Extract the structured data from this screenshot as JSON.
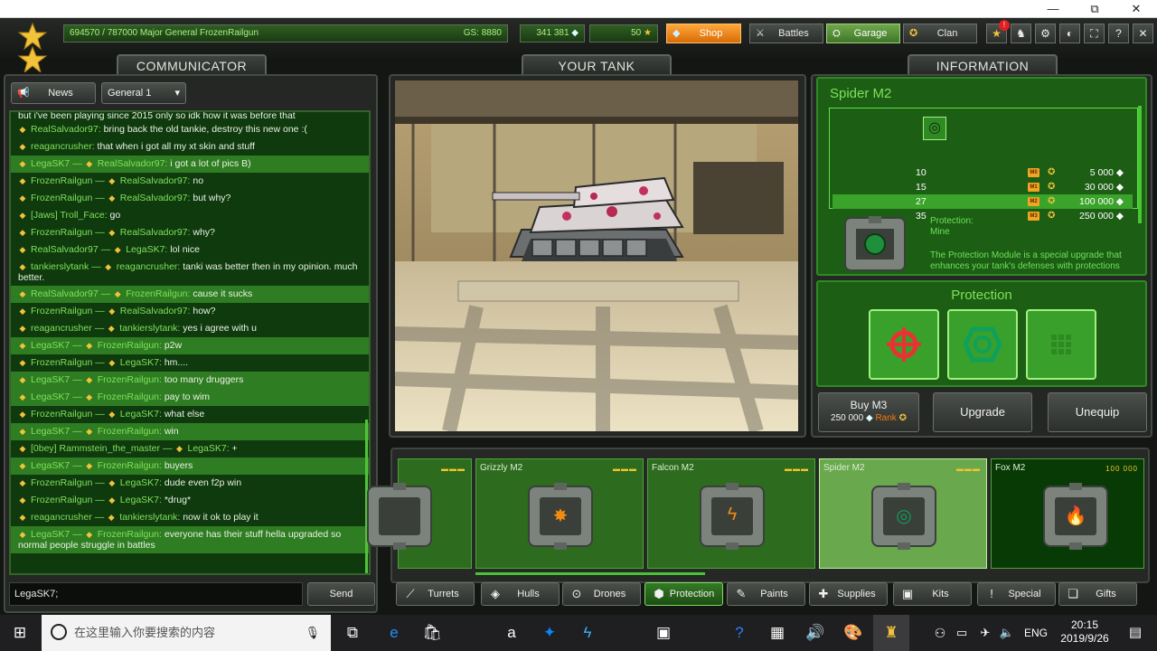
{
  "window": {
    "controls": {
      "minimize": "—",
      "restore": "⧉",
      "close": "✕"
    }
  },
  "topbar": {
    "player_info": "694570 / 787000  Major General FrozenRailgun",
    "gear_score": "GS: 8880",
    "crystals": "341 381",
    "stars": "50",
    "shop": "Shop",
    "battles": "Battles",
    "garage": "Garage",
    "clan": "Clan",
    "notification_count": "!"
  },
  "headers": {
    "communicator": "COMMUNICATOR",
    "your_tank": "YOUR TANK",
    "information": "INFORMATION"
  },
  "chat": {
    "news_button": "News",
    "channel": "General 1",
    "input_value": "LegaSK7;",
    "send": "Send",
    "truncated_top": "but i've been playing since 2015 only so idk how it was before that",
    "messages": [
      {
        "from": "RealSalvador97:",
        "to": "",
        "text": "bring back the old tankie, destroy this new one :(",
        "hl": false
      },
      {
        "from": "reagancrusher:",
        "to": "",
        "text": "that when i got all my xt skin and stuff",
        "hl": false
      },
      {
        "from": "LegaSK7",
        "to": "RealSalvador97:",
        "text": "i got a lot of pics B)",
        "hl": true
      },
      {
        "from": "FrozenRailgun",
        "to": "RealSalvador97:",
        "text": "no",
        "hl": false
      },
      {
        "from": "FrozenRailgun",
        "to": "RealSalvador97:",
        "text": "but why?",
        "hl": false
      },
      {
        "from": "[Jaws] Troll_Face:",
        "to": "",
        "text": "go",
        "hl": false
      },
      {
        "from": "FrozenRailgun",
        "to": "RealSalvador97:",
        "text": "why?",
        "hl": false
      },
      {
        "from": "RealSalvador97",
        "to": "LegaSK7:",
        "text": "lol nice",
        "hl": false
      },
      {
        "from": "tankierslytank",
        "to": "reagancrusher:",
        "text": "tanki was better then in my opinion. much better.",
        "hl": false
      },
      {
        "from": "RealSalvador97",
        "to": "FrozenRailgun:",
        "text": "cause it sucks",
        "hl": true
      },
      {
        "from": "FrozenRailgun",
        "to": "RealSalvador97:",
        "text": "how?",
        "hl": false
      },
      {
        "from": "reagancrusher",
        "to": "tankierslytank:",
        "text": "yes i agree with u",
        "hl": false
      },
      {
        "from": "LegaSK7",
        "to": "FrozenRailgun:",
        "text": "p2w",
        "hl": true
      },
      {
        "from": "FrozenRailgun",
        "to": "LegaSK7:",
        "text": "hm....",
        "hl": false
      },
      {
        "from": "LegaSK7",
        "to": "FrozenRailgun:",
        "text": "too many druggers",
        "hl": true
      },
      {
        "from": "LegaSK7",
        "to": "FrozenRailgun:",
        "text": "pay to wim",
        "hl": true
      },
      {
        "from": "FrozenRailgun",
        "to": "LegaSK7:",
        "text": "what else",
        "hl": false
      },
      {
        "from": "LegaSK7",
        "to": "FrozenRailgun:",
        "text": "win",
        "hl": true
      },
      {
        "from": "[0bey] Rammstein_the_master",
        "to": "LegaSK7:",
        "text": "+",
        "hl": false
      },
      {
        "from": "LegaSK7",
        "to": "FrozenRailgun:",
        "text": "buyers",
        "hl": true
      },
      {
        "from": "FrozenRailgun",
        "to": "LegaSK7:",
        "text": "dude even f2p win",
        "hl": false
      },
      {
        "from": "FrozenRailgun",
        "to": "LegaSK7:",
        "text": "*drug*",
        "hl": false
      },
      {
        "from": "reagancrusher",
        "to": "tankierslytank:",
        "text": "now it ok to play it",
        "hl": false
      },
      {
        "from": "LegaSK7",
        "to": "FrozenRailgun:",
        "text": "everyone has their stuff hella upgraded so normal people struggle in battles",
        "hl": true
      }
    ]
  },
  "info": {
    "item_name": "Spider M2",
    "rows": [
      {
        "rank": "10",
        "mod": "M0",
        "price": "5 000"
      },
      {
        "rank": "15",
        "mod": "M1",
        "price": "30 000"
      },
      {
        "rank": "27",
        "mod": "M2",
        "price": "100 000"
      },
      {
        "rank": "35",
        "mod": "M3",
        "price": "250 000"
      }
    ],
    "selected_row": 2,
    "protection_label": "Protection:",
    "protection_value": "Mine",
    "description": "The Protection Module is a special upgrade that enhances your tank's defenses with protections",
    "section_title": "Protection",
    "buy_label": "Buy M3",
    "buy_price": "250 000",
    "buy_rank": "Rank",
    "upgrade": "Upgrade",
    "unequip": "Unequip"
  },
  "garage": {
    "cards": [
      {
        "name": "",
        "dots": "▬▬▬",
        "icon": "",
        "style": "partial"
      },
      {
        "name": "Grizzly M2",
        "dots": "▬▬▬",
        "icon": "✸",
        "style": "normal"
      },
      {
        "name": "Falcon M2",
        "dots": "▬▬▬",
        "icon": "ϟ",
        "style": "normal"
      },
      {
        "name": "Spider M2",
        "dots": "▬▬▬",
        "icon": "◎",
        "style": "sel"
      },
      {
        "name": "Fox M2",
        "dots": "100 000",
        "icon": "🔥",
        "style": "dark"
      }
    ]
  },
  "categories": [
    {
      "label": "Turrets",
      "icon": "⟋",
      "sel": false
    },
    {
      "label": "Hulls",
      "icon": "◈",
      "sel": false
    },
    {
      "label": "Drones",
      "icon": "⊙",
      "sel": false
    },
    {
      "label": "Protection",
      "icon": "⬢",
      "sel": true
    },
    {
      "label": "Paints",
      "icon": "✎",
      "sel": false
    },
    {
      "label": "Supplies",
      "icon": "✚",
      "sel": false
    },
    {
      "label": "Kits",
      "icon": "▣",
      "sel": false
    },
    {
      "label": "Special",
      "icon": "!",
      "sel": false
    },
    {
      "label": "Gifts",
      "icon": "❏",
      "sel": false
    }
  ],
  "taskbar": {
    "search_placeholder": "在这里输入你要搜索的内容",
    "lang": "ENG",
    "time": "20:15",
    "date": "2019/9/26"
  },
  "colors": {
    "accent_green": "#2f7d22",
    "panel_green": "#1c5e14",
    "shop_orange": "#ffa73a",
    "star_gold": "#f2c23a"
  }
}
